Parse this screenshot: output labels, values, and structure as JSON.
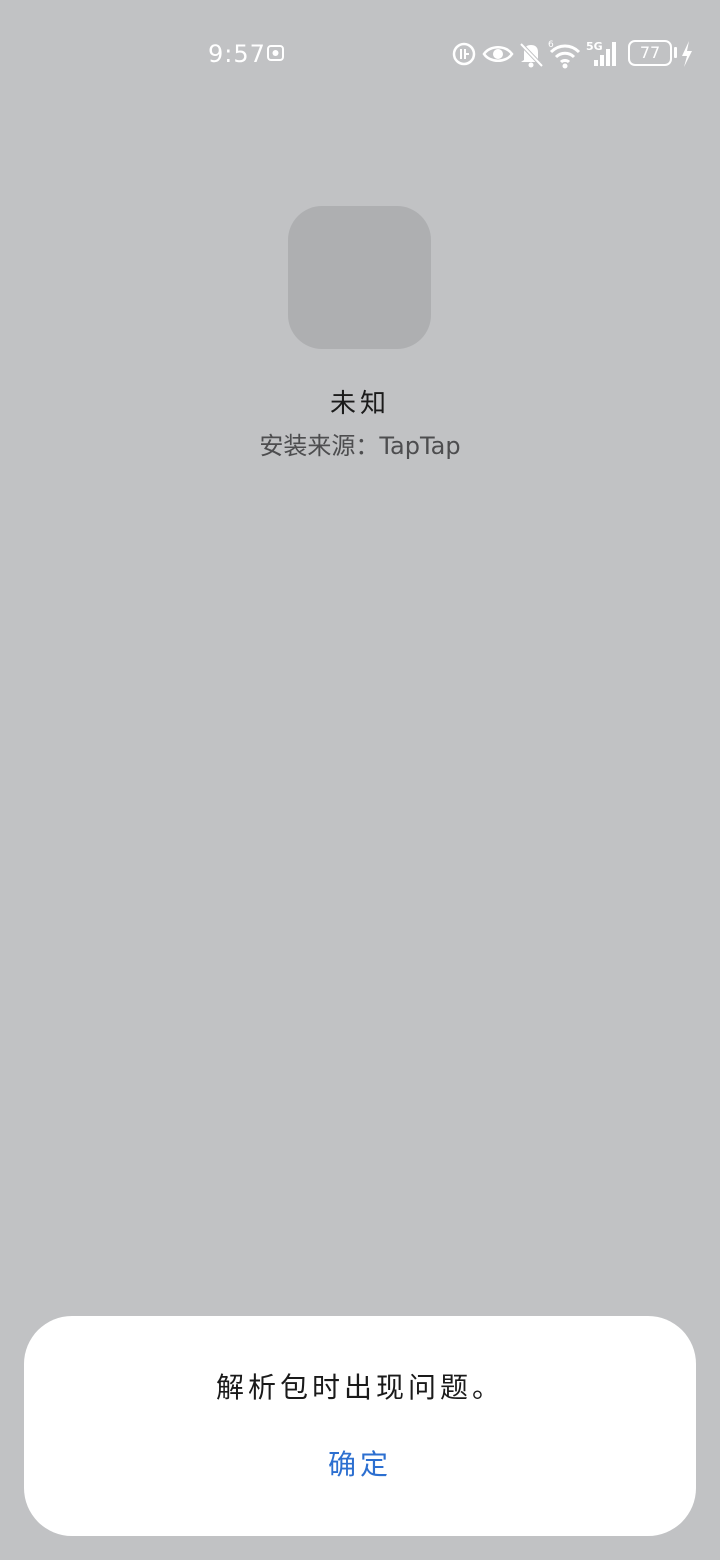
{
  "status_bar": {
    "time": "9:57",
    "battery": "77",
    "wifi_badge": "6",
    "cell_badge": "5G",
    "icons": [
      "chat-notification-icon",
      "hd-data-icon",
      "eye-comfort-icon",
      "mute-bell-icon",
      "wifi-icon",
      "cellular-signal-icon",
      "battery-icon",
      "charging-icon"
    ]
  },
  "app": {
    "name": "未知",
    "install_source": "安装来源：TapTap"
  },
  "dialog": {
    "message": "解析包时出现问题。",
    "confirm_label": "确定"
  },
  "colors": {
    "background": "#c1c2c4",
    "icon_placeholder": "#aeafb1",
    "dialog_background": "#ffffff",
    "accent": "#2c6fd0"
  }
}
